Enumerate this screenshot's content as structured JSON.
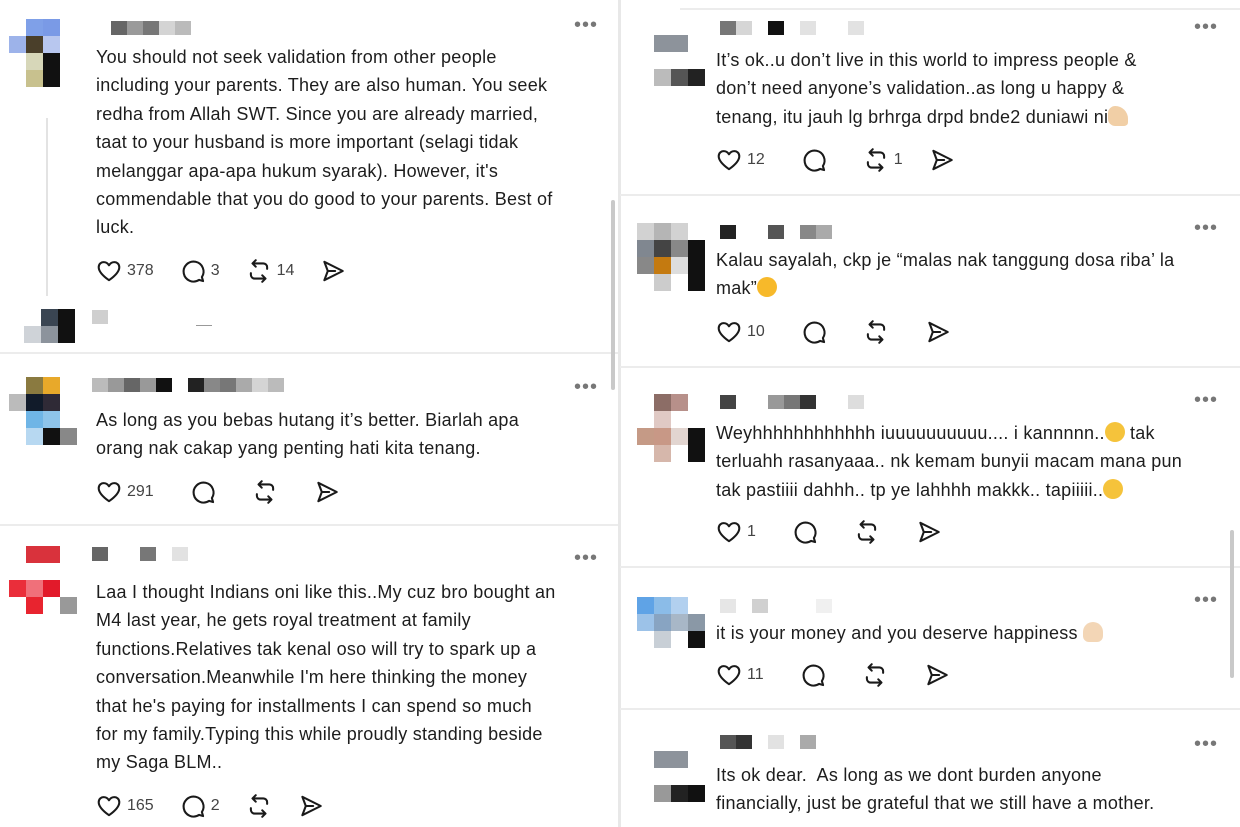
{
  "left_posts": [
    {
      "text": "You should not seek validation from other people\nincluding your parents. They are also human. You seek\nredha from Allah SWT. Since you are already married,\ntaat to your husband is more important (selagi tidak\nmelanggar apa-apa hukum syarak). However, it's\ncommendable that you do good to your parents. Best of\nluck.",
      "likes": "378",
      "replies": "3",
      "reposts": "14"
    },
    {
      "text": "As long as you bebas hutang it’s better. Biarlah apa\norang nak cakap yang penting hati kita tenang.",
      "likes": "291",
      "replies": "",
      "reposts": ""
    },
    {
      "text": "Laa I thought Indians oni like this..My cuz bro bought an\nM4 last year, he gets royal treatment at family\nfunctions.Relatives tak kenal oso will try to spark up a\nconversation.Meanwhile I'm here thinking the money\nthat he's paying for installments I can spend so much\nfor my family.Typing this while proudly standing beside\nmy Saga BLM..",
      "likes": "165",
      "replies": "2",
      "reposts": ""
    }
  ],
  "right_posts": [
    {
      "text_before": "It’s ok..u don’t live in this world to impress people &\ndon’t need anyone’s validation..as long u happy &\ntenang, itu jauh lg brhrga drpd bnde2 duniawi ni",
      "emoji_end": "flexed-biceps",
      "likes": "12",
      "replies": "",
      "reposts": "1"
    },
    {
      "text_before": "Kalau sayalah, ckp je “malas nak tanggung dosa riba’ la\nmak”",
      "emoji_end": "rolling-laughing",
      "likes": "10",
      "replies": "",
      "reposts": ""
    },
    {
      "line1": "Weyhhhhhhhhhhhh iuuuuuuuuuu.... i kannnnn..",
      "line1_after": " tak",
      "line2": "terluahh rasanyaaa.. nk kemam bunyii macam mana pun",
      "line3": "tak pastiiii dahhh.. tp ye lahhhh makkk.. tapiiiii..",
      "emoji": "pleading-face",
      "likes": "1",
      "replies": "",
      "reposts": ""
    },
    {
      "text_before": "it is your money and you deserve happiness",
      "emoji_end": "victory-hand",
      "likes": "11",
      "replies": "",
      "reposts": ""
    },
    {
      "text": "Its ok dear.  As long as we dont burden anyone\nfinancially, just be grateful that we still have a mother.",
      "likes": "",
      "replies": "",
      "reposts": ""
    }
  ],
  "more_label": "•••",
  "colors": {
    "text": "#1d1d1d",
    "icon": "#1a1a1a",
    "count": "#444444",
    "divider": "#ececec",
    "thread_line": "#e3e3e3"
  },
  "icons": {
    "like": "heart-icon",
    "reply": "speech-bubble-icon",
    "repost": "repost-arrows-icon",
    "share": "send-icon",
    "more": "more-dots-icon"
  }
}
